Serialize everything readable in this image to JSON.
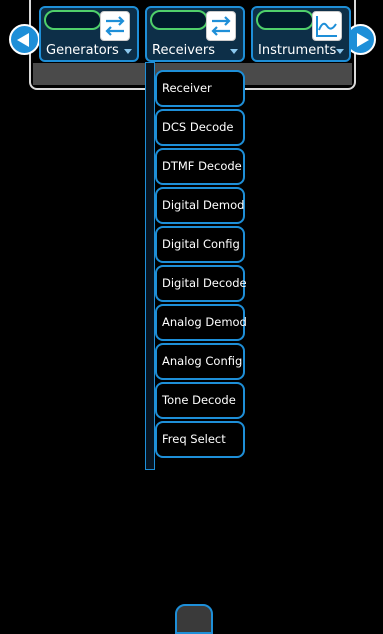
{
  "tabs": [
    {
      "label": "Generators",
      "icon": "swap-arrows-icon"
    },
    {
      "label": "Receivers",
      "icon": "swap-arrows-icon"
    },
    {
      "label": "Instruments",
      "icon": "waveform-icon"
    }
  ],
  "nav": {
    "left_icon": "chevron-left-icon",
    "right_icon": "chevron-right-icon"
  },
  "dropdown": {
    "items": [
      "Receiver",
      "DCS Decode",
      "DTMF Decode",
      "Digital Demod",
      "Digital Config",
      "Digital Decode",
      "Analog Demod",
      "Analog Config",
      "Tone Decode",
      "Freq Select"
    ]
  },
  "colors": {
    "accent": "#1e8fd8",
    "active_pill": "#4fcf6a",
    "background": "#000000"
  }
}
